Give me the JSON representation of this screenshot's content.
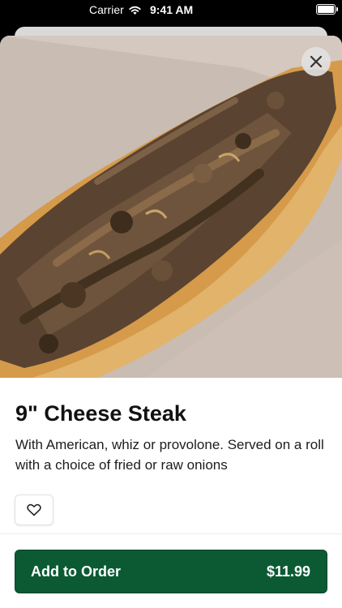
{
  "status_bar": {
    "carrier": "Carrier",
    "time": "9:41 AM"
  },
  "item": {
    "image_subject": "cheesesteak-sandwich-photo",
    "title": "9\" Cheese Steak",
    "description": "With American, whiz or provolone. Served on a roll with a choice of fried or raw onions"
  },
  "actions": {
    "close_icon": "close-icon",
    "favorite_icon": "heart-icon",
    "add_to_order_label": "Add to Order",
    "price": "$11.99"
  },
  "colors": {
    "primary_button": "#0c5a34",
    "text": "#111111"
  }
}
